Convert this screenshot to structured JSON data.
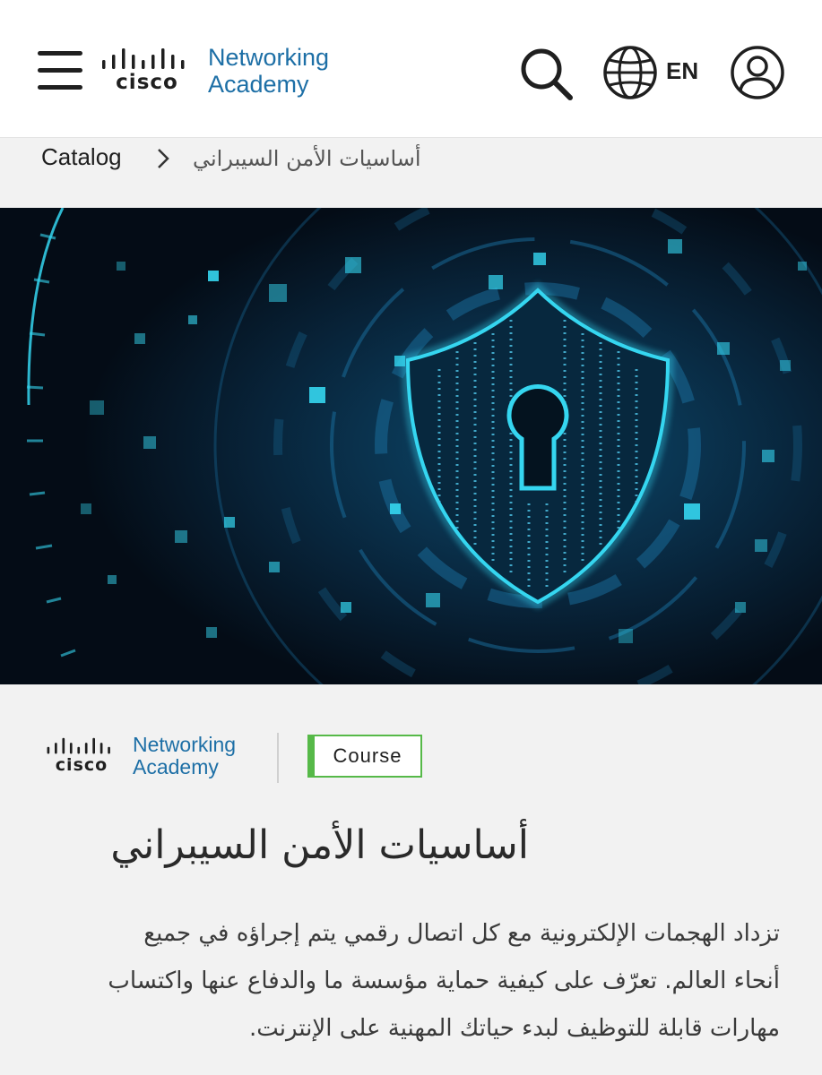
{
  "header": {
    "logo": {
      "brand": "cisco",
      "line1": "Networking",
      "line2": "Academy"
    },
    "language_label": "EN",
    "icons": [
      "menu-icon",
      "search-icon",
      "globe-icon",
      "user-icon"
    ]
  },
  "breadcrumb": {
    "root": "Catalog",
    "current": "أساسيات الأمن السيبراني"
  },
  "hero": {
    "icon": "shield-keyhole-icon"
  },
  "course": {
    "logo": {
      "brand": "cisco",
      "line1": "Networking",
      "line2": "Academy"
    },
    "badge": "Course",
    "title": "أساسيات الأمن السيبراني",
    "description_lines": [
      "تزداد الهجمات الإلكترونية مع كل اتصال رقمي يتم إجراؤه في جميع",
      "أنحاء العالم. تعرّف على كيفية حماية مؤسسة ما والدفاع عنها واكتساب",
      "مهارات قابلة للتوظيف لبدء حياتك المهنية على الإنترنت."
    ]
  },
  "colors": {
    "accent_blue": "#1d6fa6",
    "badge_green": "#56b948",
    "hero_cyan": "#35d6f0",
    "hero_bg": "#06121f"
  }
}
